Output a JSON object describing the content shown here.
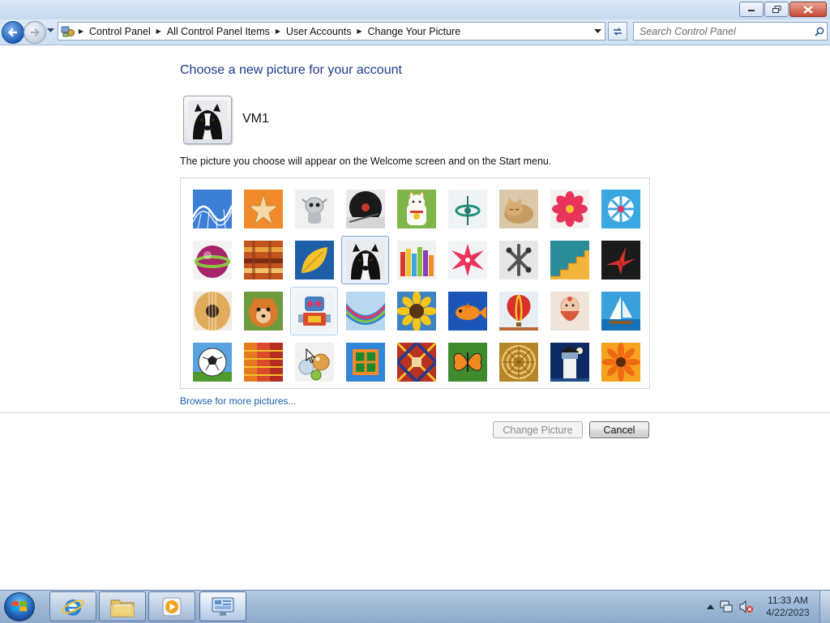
{
  "window": {
    "caption_buttons": [
      "minimize-icon",
      "maximize-icon",
      "close-icon"
    ]
  },
  "nav": {
    "breadcrumbs": [
      "Control Panel",
      "All Control Panel Items",
      "User Accounts",
      "Change Your Picture"
    ],
    "search_placeholder": "Search Control Panel"
  },
  "page": {
    "heading": "Choose a new picture for your account",
    "username": "VM1",
    "description": "The picture you choose will appear on the Welcome screen and on the Start menu.",
    "browse_link": "Browse for more pictures...",
    "change_button": "Change Picture",
    "cancel_button": "Cancel"
  },
  "pictures": {
    "selected": "dog",
    "hovered": "robot",
    "items": [
      "roller-coaster",
      "starfish",
      "toy-alien",
      "record-player",
      "lucky-cat",
      "spinning-top",
      "kitten",
      "flower",
      "pinwheel",
      "ball",
      "fabric",
      "leaf",
      "dog",
      "crayons",
      "star",
      "jacks",
      "stairs",
      "paper-crane",
      "guitar",
      "puppy",
      "robot",
      "hammock",
      "sunflower",
      "fish",
      "hot-air-balloon",
      "doll",
      "sailboat",
      "soccer-ball",
      "textile",
      "marbles",
      "window",
      "rug",
      "butterfly",
      "shell",
      "lighthouse",
      "gerbera"
    ]
  },
  "taskbar": {
    "apps": [
      "internet-explorer",
      "file-explorer",
      "media-player",
      "control-panel"
    ],
    "time": "11:33 AM",
    "date": "4/22/2023"
  }
}
